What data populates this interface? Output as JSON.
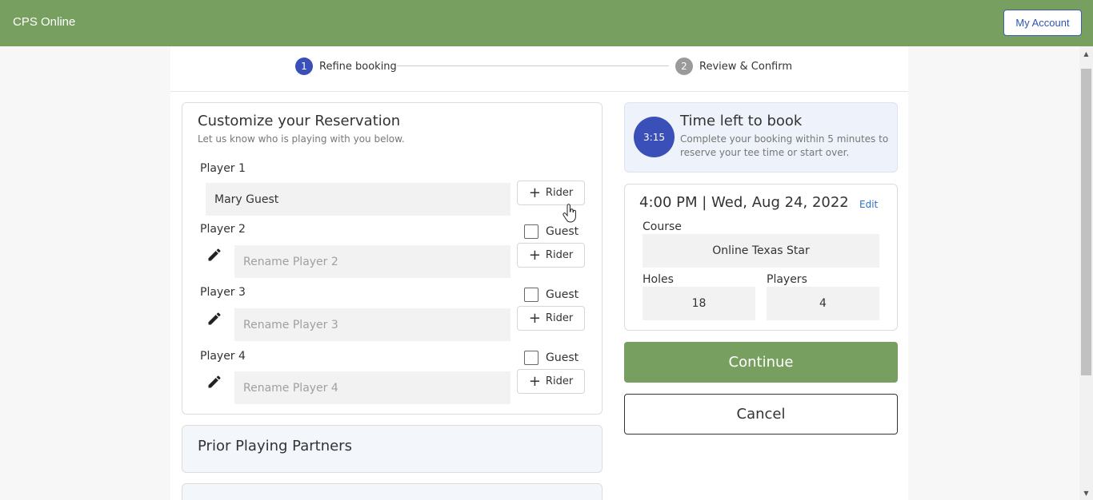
{
  "header": {
    "brand": "CPS Online",
    "account_label": "My Account"
  },
  "stepper": {
    "steps": [
      {
        "number": "1",
        "label": "Refine booking",
        "active": true
      },
      {
        "number": "2",
        "label": "Review & Confirm",
        "active": false
      }
    ]
  },
  "customize": {
    "title": "Customize your Reservation",
    "subtitle": "Let us know who is playing with you below.",
    "rider_label": "Rider",
    "guest_label": "Guest",
    "players": [
      {
        "label": "Player 1",
        "value": "Mary Guest",
        "placeholder": ""
      },
      {
        "label": "Player 2",
        "value": "",
        "placeholder": "Rename Player 2"
      },
      {
        "label": "Player 3",
        "value": "",
        "placeholder": "Rename Player 3"
      },
      {
        "label": "Player 4",
        "value": "",
        "placeholder": "Rename Player 4"
      }
    ]
  },
  "prior_partners": {
    "title": "Prior Playing Partners"
  },
  "timer": {
    "time": "3:15",
    "title": "Time left to book",
    "text": "Complete your booking within 5 minutes to reserve your tee time or start over."
  },
  "booking": {
    "datetime": "4:00 PM | Wed, Aug 24, 2022",
    "edit_label": "Edit",
    "course_label": "Course",
    "course_value": "Online Texas Star",
    "holes_label": "Holes",
    "holes_value": "18",
    "players_label": "Players",
    "players_value": "4"
  },
  "actions": {
    "continue_label": "Continue",
    "cancel_label": "Cancel"
  },
  "colors": {
    "brand_green": "#77a060",
    "accent_blue": "#3b4fb8"
  }
}
